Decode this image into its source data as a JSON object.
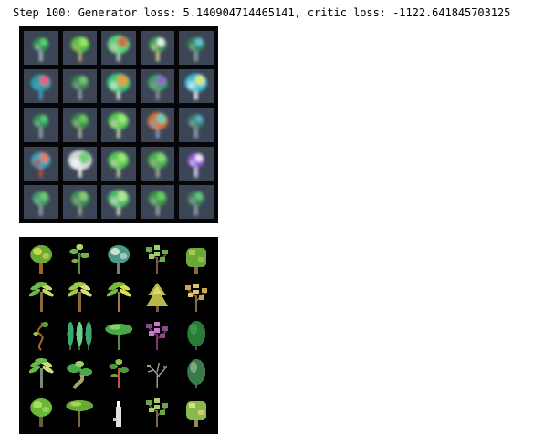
{
  "output": {
    "log_text": "Step 100: Generator loss: 5.140904714465141, critic loss: -1122.641845703125"
  },
  "generated_grid": {
    "rows": 5,
    "cols": 5,
    "background": "#3b4555",
    "cells": [
      {
        "trunk": "#b6c1c9",
        "canopy": "#2e9a55",
        "accent": "#5fdc73",
        "spread": 0.35
      },
      {
        "trunk": "#c9b16a",
        "canopy": "#58c94a",
        "accent": "#9ef06a",
        "spread": 0.5
      },
      {
        "trunk": "#d8d2c0",
        "canopy": "#5ae07a",
        "accent": "#e0604a",
        "spread": 0.7
      },
      {
        "trunk": "#e6d68a",
        "canopy": "#3aa85a",
        "accent": "#ffffff",
        "spread": 0.45
      },
      {
        "trunk": "#a0a8b4",
        "canopy": "#2f8f52",
        "accent": "#6acff0",
        "spread": 0.4
      },
      {
        "trunk": "#4aa0d8",
        "canopy": "#2aa0a0",
        "accent": "#ff5a8a",
        "spread": 0.6
      },
      {
        "trunk": "#9aa3ad",
        "canopy": "#3c8a4a",
        "accent": "#7fd07a",
        "spread": 0.45
      },
      {
        "trunk": "#f2f2e0",
        "canopy": "#3ad07a",
        "accent": "#ff9a3a",
        "spread": 0.75
      },
      {
        "trunk": "#9a9aa0",
        "canopy": "#3aa86a",
        "accent": "#a65ae0",
        "spread": 0.55
      },
      {
        "trunk": "#ffffff",
        "canopy": "#3ac8e0",
        "accent": "#f0f080",
        "spread": 0.7
      },
      {
        "trunk": "#a4aab4",
        "canopy": "#2e9a55",
        "accent": "#5ad07a",
        "spread": 0.35
      },
      {
        "trunk": "#bfb4a0",
        "canopy": "#3a9a4a",
        "accent": "#76d06a",
        "spread": 0.45
      },
      {
        "trunk": "#cfd8b0",
        "canopy": "#5ad05a",
        "accent": "#a8f07a",
        "spread": 0.6
      },
      {
        "trunk": "#8aa0c8",
        "canopy": "#e07a3a",
        "accent": "#5ae0c8",
        "spread": 0.6
      },
      {
        "trunk": "#a0a8b4",
        "canopy": "#3a8a6a",
        "accent": "#5ab8e0",
        "spread": 0.35
      },
      {
        "trunk": "#d04a3a",
        "canopy": "#3aa8c8",
        "accent": "#ff7a5a",
        "spread": 0.55
      },
      {
        "trunk": "#ffffff",
        "canopy": "#e8e8e8",
        "accent": "#5ad06a",
        "spread": 0.8
      },
      {
        "trunk": "#c8d8a0",
        "canopy": "#5ad05a",
        "accent": "#9ef07a",
        "spread": 0.6
      },
      {
        "trunk": "#b0b8a0",
        "canopy": "#4ab84a",
        "accent": "#8ae07a",
        "spread": 0.55
      },
      {
        "trunk": "#e8e0ff",
        "canopy": "#9a5ae0",
        "accent": "#ffffff",
        "spread": 0.4
      },
      {
        "trunk": "#a0b0a0",
        "canopy": "#3aa86a",
        "accent": "#7ad07a",
        "spread": 0.4
      },
      {
        "trunk": "#b0a890",
        "canopy": "#3a9a5a",
        "accent": "#9ad07a",
        "spread": 0.5
      },
      {
        "trunk": "#e0e0d0",
        "canopy": "#4ac86a",
        "accent": "#c0f0a0",
        "spread": 0.65
      },
      {
        "trunk": "#a8b0a8",
        "canopy": "#3a9a4a",
        "accent": "#7ad06a",
        "spread": 0.5
      },
      {
        "trunk": "#a0a8b4",
        "canopy": "#3a8a5a",
        "accent": "#6ad08a",
        "spread": 0.4
      }
    ]
  },
  "real_grid": {
    "rows": 5,
    "cols": 5,
    "background": "#000000",
    "cells": [
      {
        "shape": "round",
        "trunk": "#a0642a",
        "canopy": "#6aa83a",
        "accent": "#c8d84a"
      },
      {
        "shape": "sapling",
        "trunk": "#5a8a3a",
        "canopy": "#6ab84a",
        "accent": "#a8d86a"
      },
      {
        "shape": "round",
        "trunk": "#7a7a7a",
        "canopy": "#4a9a8a",
        "accent": "#c8e0d0"
      },
      {
        "shape": "sparse",
        "trunk": "#7a5a3a",
        "canopy": "#5ab84a",
        "accent": "#9ad06a"
      },
      {
        "shape": "bush",
        "trunk": "#8a6a3a",
        "canopy": "#6aa83a",
        "accent": "#a8c85a"
      },
      {
        "shape": "palm",
        "trunk": "#8a6a3a",
        "canopy": "#6ab84a",
        "accent": "#c8d86a"
      },
      {
        "shape": "palm",
        "trunk": "#8a6a3a",
        "canopy": "#9ac84a",
        "accent": "#d8e07a"
      },
      {
        "shape": "palm",
        "trunk": "#a07a3a",
        "canopy": "#7ab83a",
        "accent": "#d8e04a"
      },
      {
        "shape": "pine",
        "trunk": "#7a5a3a",
        "canopy": "#b8b84a",
        "accent": "#e0d86a"
      },
      {
        "shape": "sparse",
        "trunk": "#8a6a3a",
        "canopy": "#c8a84a",
        "accent": "#e0c86a"
      },
      {
        "shape": "vine",
        "trunk": "#a0642a",
        "canopy": "#5a9a3a",
        "accent": "#8ac84a"
      },
      {
        "shape": "cypress",
        "trunk": "#3a6a4a",
        "canopy": "#3aa86a",
        "accent": "#6ad08a"
      },
      {
        "shape": "umbrella",
        "trunk": "#5a8a3a",
        "canopy": "#4aa84a",
        "accent": "#8ad06a"
      },
      {
        "shape": "sparse",
        "trunk": "#7a3a6a",
        "canopy": "#8a4a8a",
        "accent": "#c87ac8"
      },
      {
        "shape": "oval",
        "trunk": "#3a5a3a",
        "canopy": "#2a7a3a",
        "accent": "#4aa84a"
      },
      {
        "shape": "palm",
        "trunk": "#7a8a7a",
        "canopy": "#6ab84a",
        "accent": "#c8e07a"
      },
      {
        "shape": "bonsai",
        "trunk": "#b0a070",
        "canopy": "#4aa84a",
        "accent": "#9ad06a"
      },
      {
        "shape": "sapling",
        "trunk": "#c05a3a",
        "canopy": "#4a9a3a",
        "accent": "#8ac84a"
      },
      {
        "shape": "dead",
        "trunk": "#9a9a9a",
        "canopy": "#5a8a4a",
        "accent": "#8ab86a"
      },
      {
        "shape": "oval",
        "trunk": "#4a6a4a",
        "canopy": "#3a7a4a",
        "accent": "#a8c8a0"
      },
      {
        "shape": "round",
        "trunk": "#6a5a3a",
        "canopy": "#6ab83a",
        "accent": "#a8e05a"
      },
      {
        "shape": "umbrella",
        "trunk": "#7a6a3a",
        "canopy": "#6aa83a",
        "accent": "#a8d05a"
      },
      {
        "shape": "candle",
        "trunk": "#e0e0e0",
        "canopy": "#c8c8c8",
        "accent": "#ffffff"
      },
      {
        "shape": "sparse",
        "trunk": "#7a6a4a",
        "canopy": "#6aa84a",
        "accent": "#a8d06a"
      },
      {
        "shape": "bush",
        "trunk": "#9a8a4a",
        "canopy": "#8ab84a",
        "accent": "#d8e07a"
      }
    ]
  }
}
